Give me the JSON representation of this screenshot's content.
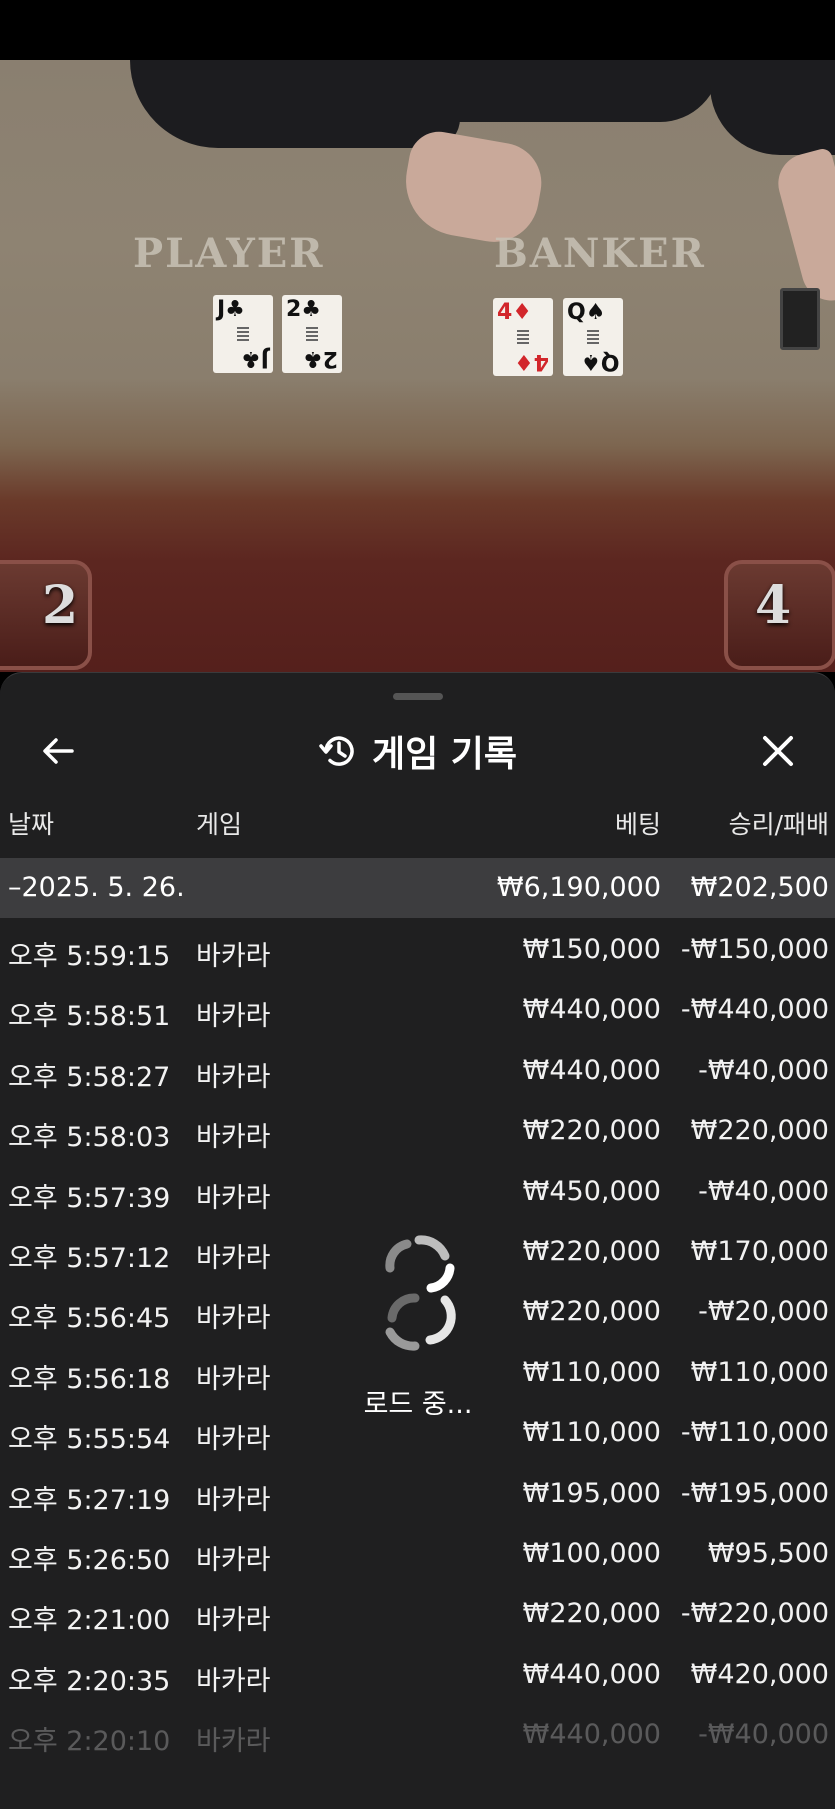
{
  "video": {
    "player_label": "PLAYER",
    "banker_label": "BANKER",
    "player_cards": [
      {
        "rank": "J",
        "suit": "♣",
        "color": "black"
      },
      {
        "rank": "2",
        "suit": "♣",
        "color": "black"
      }
    ],
    "banker_cards": [
      {
        "rank": "4",
        "suit": "♦",
        "color": "red"
      },
      {
        "rank": "Q",
        "suit": "♠",
        "color": "black"
      }
    ],
    "player_score": "2",
    "banker_score": "4"
  },
  "sheet": {
    "title": "게임 기록",
    "back_icon": "arrow-left-icon",
    "history_icon": "history-icon",
    "close_icon": "close-icon",
    "columns": {
      "date": "날짜",
      "game": "게임",
      "bet": "베팅",
      "win_loss": "승리/패배"
    },
    "summary": {
      "date": "–2025. 5. 26.",
      "bet": "₩6,190,000",
      "win_loss": "₩202,500"
    },
    "rows": [
      {
        "time": "오후 5:59:15",
        "game": "바카라",
        "bet": "₩150,000",
        "win_loss": "-₩150,000"
      },
      {
        "time": "오후 5:58:51",
        "game": "바카라",
        "bet": "₩440,000",
        "win_loss": "-₩440,000"
      },
      {
        "time": "오후 5:58:27",
        "game": "바카라",
        "bet": "₩440,000",
        "win_loss": "-₩40,000"
      },
      {
        "time": "오후 5:58:03",
        "game": "바카라",
        "bet": "₩220,000",
        "win_loss": "₩220,000"
      },
      {
        "time": "오후 5:57:39",
        "game": "바카라",
        "bet": "₩450,000",
        "win_loss": "-₩40,000"
      },
      {
        "time": "오후 5:57:12",
        "game": "바카라",
        "bet": "₩220,000",
        "win_loss": "₩170,000"
      },
      {
        "time": "오후 5:56:45",
        "game": "바카라",
        "bet": "₩220,000",
        "win_loss": "-₩20,000"
      },
      {
        "time": "오후 5:56:18",
        "game": "바카라",
        "bet": "₩110,000",
        "win_loss": "₩110,000"
      },
      {
        "time": "오후 5:55:54",
        "game": "바카라",
        "bet": "₩110,000",
        "win_loss": "-₩110,000"
      },
      {
        "time": "오후 5:27:19",
        "game": "바카라",
        "bet": "₩195,000",
        "win_loss": "-₩195,000"
      },
      {
        "time": "오후 5:26:50",
        "game": "바카라",
        "bet": "₩100,000",
        "win_loss": "₩95,500"
      },
      {
        "time": "오후 2:21:00",
        "game": "바카라",
        "bet": "₩220,000",
        "win_loss": "-₩220,000"
      },
      {
        "time": "오후 2:20:35",
        "game": "바카라",
        "bet": "₩440,000",
        "win_loss": "₩420,000"
      },
      {
        "time": "오후 2:20:10",
        "game": "바카라",
        "bet": "₩440,000",
        "win_loss": "-₩40,000"
      }
    ],
    "loading_text": "로드 중...",
    "loading_icon": "spinner-icon"
  }
}
